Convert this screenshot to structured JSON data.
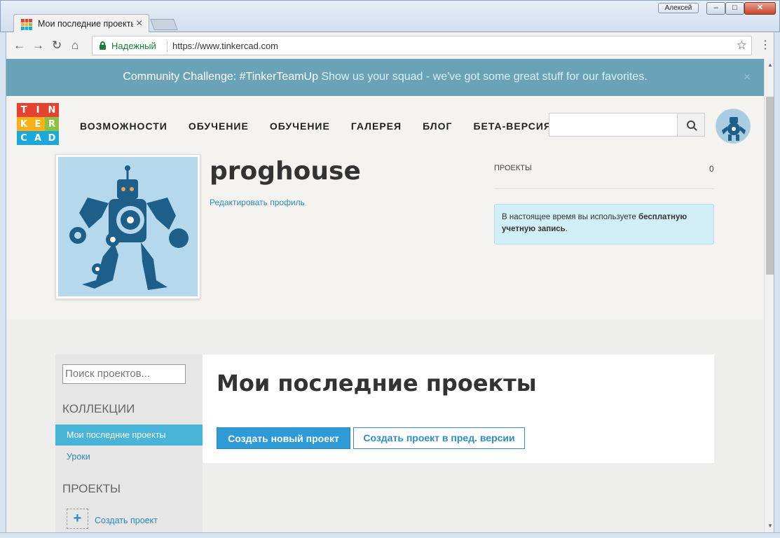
{
  "browser": {
    "tab_title": "Мои последние проекты",
    "user_button": "Алексей",
    "secure_label": "Надежный",
    "url": "https://www.tinkercad.com"
  },
  "banner": {
    "title": "Community Challenge: #TinkerTeamUp",
    "subtitle": "Show us your squad - we've got some great stuff for our favorites."
  },
  "logo": {
    "letters": [
      "T",
      "I",
      "N",
      "K",
      "E",
      "R",
      "C",
      "A",
      "D"
    ],
    "colors": [
      "#e64232",
      "#e64232",
      "#e64232",
      "#fbaf18",
      "#fbaf18",
      "#89c33f",
      "#1aa9da",
      "#1aa9da",
      "#1aa9da"
    ]
  },
  "nav": {
    "items": [
      "ВОЗМОЖНОСТИ",
      "ОБУЧЕНИЕ",
      "ОБУЧЕНИЕ",
      "ГАЛЕРЕЯ",
      "БЛОГ",
      "БЕТА-ВЕРСИЯ"
    ]
  },
  "profile": {
    "username": "proghouse",
    "edit_link": "Редактировать профиль",
    "projects_label": "ПРОЕКТЫ",
    "projects_count": "0",
    "info_prefix": "В настоящее время вы используете ",
    "info_bold": "бесплатную учетную запись",
    "info_suffix": "."
  },
  "sidebar": {
    "search_placeholder": "Поиск проектов...",
    "collections_heading": "КОЛЛЕКЦИИ",
    "items": [
      "Мои последние проекты",
      "Уроки"
    ],
    "projects_heading": "ПРОЕКТЫ",
    "create_label": "Создать проект"
  },
  "main": {
    "title": "Мои последние проекты",
    "create_new_button": "Создать новый проект",
    "create_prev_button": "Создать проект в пред. версии"
  },
  "colors": {
    "banner": "#6aa3b8",
    "accent": "#2e9ad6",
    "link": "#2a8ab9",
    "active_item": "#47b4d8"
  }
}
